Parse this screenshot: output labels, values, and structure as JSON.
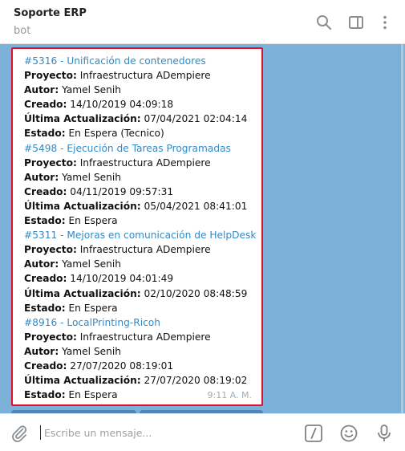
{
  "header": {
    "title": "Soporte ERP",
    "subtitle": "bot",
    "icons": [
      "search-icon",
      "sidebar-toggle-icon",
      "more-vertical-icon"
    ]
  },
  "message": {
    "tickets": [
      {
        "title": "#5316 - Unificación de contenedores",
        "project_label": "Proyecto:",
        "project": "Infraestructura ADempiere",
        "author_label": "Autor:",
        "author": "Yamel Senih",
        "created_label": "Creado:",
        "created": "14/10/2019 04:09:18",
        "updated_label": "Última Actualización:",
        "updated": "07/04/2021 02:04:14",
        "status_label": "Estado:",
        "status": "En Espera (Tecnico)"
      },
      {
        "title": "#5498 - Ejecución de Tareas Programadas",
        "project_label": "Proyecto:",
        "project": "Infraestructura ADempiere",
        "author_label": "Autor:",
        "author": "Yamel Senih",
        "created_label": "Creado:",
        "created": "04/11/2019 09:57:31",
        "updated_label": "Última Actualización:",
        "updated": "05/04/2021 08:41:01",
        "status_label": "Estado:",
        "status": "En Espera"
      },
      {
        "title": "#5311 - Mejoras en comunicación de HelpDesk",
        "project_label": "Proyecto:",
        "project": "Infraestructura ADempiere",
        "author_label": "Autor:",
        "author": "Yamel Senih",
        "created_label": "Creado:",
        "created": "14/10/2019 04:01:49",
        "updated_label": "Última Actualización:",
        "updated": "02/10/2020 08:48:59",
        "status_label": "Estado:",
        "status": "En Espera"
      },
      {
        "title": "#8916 - LocalPrinting-Ricoh",
        "project_label": "Proyecto:",
        "project": "Infraestructura ADempiere",
        "author_label": "Autor:",
        "author": "Yamel Senih",
        "created_label": "Creado:",
        "created": "27/07/2020 08:19:01",
        "updated_label": "Última Actualización:",
        "updated": "27/07/2020 08:19:02",
        "status_label": "Estado:",
        "status": "En Espera"
      }
    ],
    "time": "9:11 A. M."
  },
  "input_bar": {
    "placeholder": "Escribe un mensaje...",
    "icons": [
      "attach-icon",
      "commands-icon",
      "emoji-icon",
      "microphone-icon"
    ]
  },
  "colors": {
    "chat_background": "#7bb1d9",
    "link": "#2f8bc9",
    "highlight_border": "#e0102a"
  }
}
